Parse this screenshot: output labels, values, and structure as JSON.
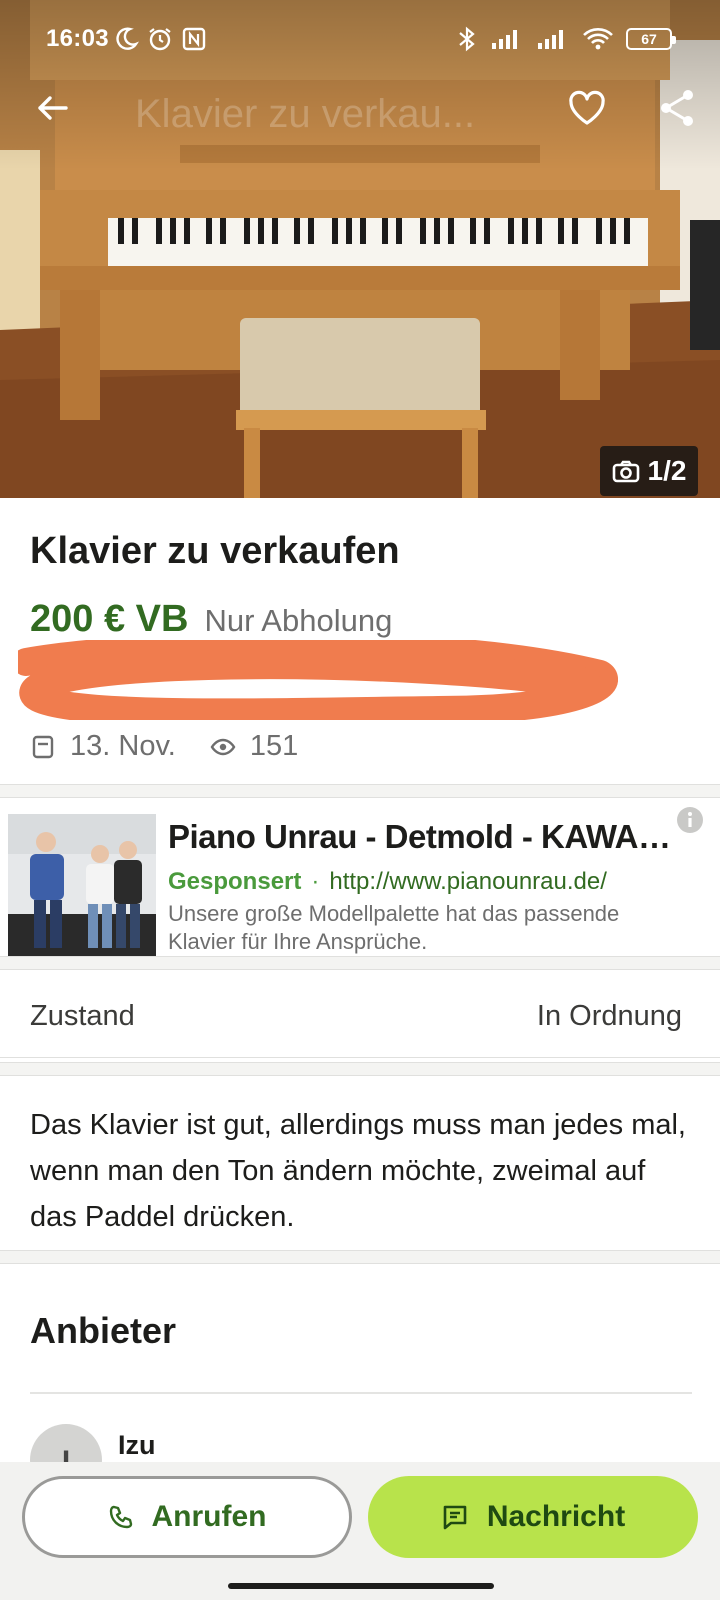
{
  "status_bar": {
    "time": "16:03",
    "battery": "67"
  },
  "toolbar": {
    "ghost_title": "Klavier zu verkau..."
  },
  "photo": {
    "counter": "1/2"
  },
  "listing": {
    "title": "Klavier zu verkaufen",
    "price": "200 € VB",
    "shipping": "Nur Abholung",
    "date": "13. Nov.",
    "views": "151"
  },
  "ad": {
    "title": "Piano Unrau - Detmold - KAWAI ...",
    "sponsored": "Gesponsert",
    "separator": "·",
    "url": "http://www.pianounrau.de/",
    "description": "Unsere große Modellpalette hat das passende Klavier für Ihre Ansprüche."
  },
  "attributes": {
    "key": "Zustand",
    "value": "In Ordnung"
  },
  "description": "Das Klavier ist gut, allerdings muss man jedes mal, wenn man den Ton ändern möchte, zweimal auf das Paddel drücken.",
  "seller": {
    "heading": "Anbieter",
    "name": "Izu",
    "initial": "I"
  },
  "actions": {
    "call": "Anrufen",
    "message": "Nachricht"
  },
  "colors": {
    "price_green": "#326b21",
    "message_button": "#b8e34b",
    "redaction": "#f07c4e"
  },
  "icons": [
    "back-arrow-icon",
    "heart-icon",
    "share-icon",
    "camera-icon",
    "calendar-icon",
    "eye-icon",
    "info-icon",
    "phone-icon",
    "message-icon"
  ]
}
